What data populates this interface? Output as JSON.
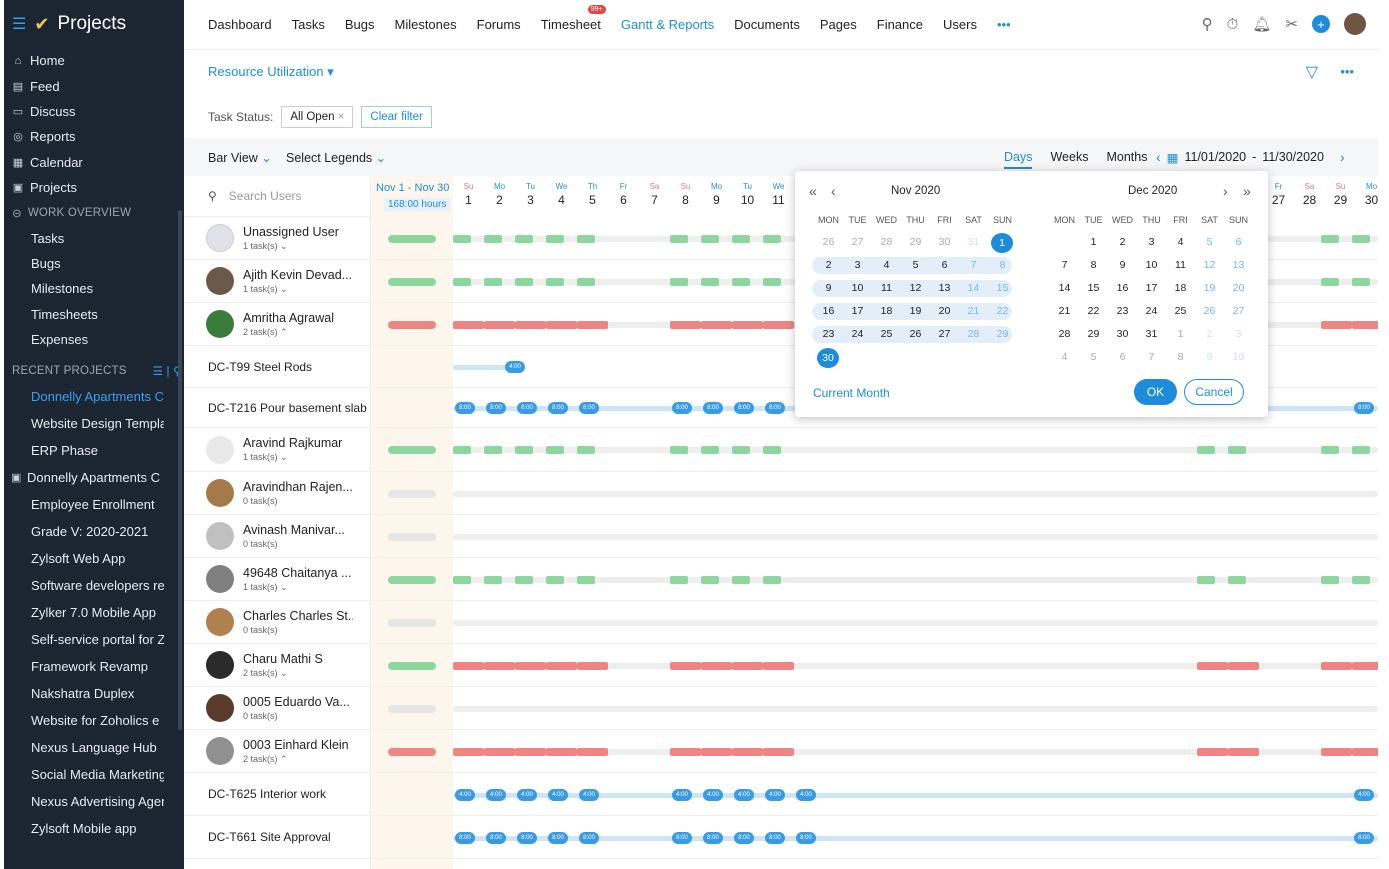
{
  "sidebar": {
    "title": "Projects",
    "items": [
      "Home",
      "Feed",
      "Discuss",
      "Reports",
      "Calendar",
      "Projects"
    ],
    "work_overview": "WORK OVERVIEW",
    "work_items": [
      "Tasks",
      "Bugs",
      "Milestones",
      "Timesheets",
      "Expenses"
    ],
    "recent_projects": "RECENT PROJECTS",
    "projects": [
      "Donnelly Apartments C",
      "Website Design Templa",
      "ERP Phase",
      "Donnelly Apartments C",
      "Employee Enrollment",
      "Grade V: 2020-2021",
      "Zylsoft Web App",
      "Software developers re",
      "Zylker 7.0 Mobile App",
      "Self-service portal for Z",
      "Framework Revamp",
      "Nakshatra Duplex",
      "Website for Zoholics e",
      "Nexus Language Hub",
      "Social Media Marketing",
      "Nexus Advertising Ager",
      "Zylsoft Mobile app"
    ]
  },
  "nav": {
    "items": [
      "Dashboard",
      "Tasks",
      "Bugs",
      "Milestones",
      "Forums",
      "Timesheet",
      "Gantt & Reports",
      "Documents",
      "Pages",
      "Finance",
      "Users",
      "•••"
    ],
    "badge": "99+"
  },
  "toolbar": {
    "report": "Resource Utilization",
    "task_status_label": "Task Status:",
    "chip": "All Open",
    "clear": "Clear filter",
    "bar_view": "Bar View",
    "legends": "Select Legends",
    "views": [
      "Days",
      "Weeks",
      "Months"
    ],
    "range_start": "11/01/2020",
    "range_sep": "-",
    "range_end": "11/30/2020"
  },
  "grid": {
    "search_placeholder": "Search Users",
    "summary_title": "Nov 1 - Nov 30",
    "summary_hours": "168:00 hours",
    "days": [
      {
        "n": "Su",
        "d": "1"
      },
      {
        "n": "Mo",
        "d": "2"
      },
      {
        "n": "Tu",
        "d": "3"
      },
      {
        "n": "We",
        "d": "4"
      },
      {
        "n": "Th",
        "d": "5"
      },
      {
        "n": "Fr",
        "d": "6"
      },
      {
        "n": "Sa",
        "d": "7"
      },
      {
        "n": "Su",
        "d": "8"
      },
      {
        "n": "Mo",
        "d": "9"
      },
      {
        "n": "Tu",
        "d": "10"
      },
      {
        "n": "We",
        "d": "11"
      }
    ],
    "days_right": [
      {
        "n": "Fr",
        "d": "27"
      },
      {
        "n": "Sa",
        "d": "28"
      },
      {
        "n": "Su",
        "d": "29"
      },
      {
        "n": "Mo",
        "d": "30"
      }
    ],
    "rows": [
      {
        "type": "user",
        "name": "Unassigned User",
        "tasks": "1 task(s)",
        "open": false
      },
      {
        "type": "user",
        "name": "Ajith Kevin Devad...",
        "tasks": "1 task(s)",
        "open": false
      },
      {
        "type": "user",
        "name": "Amritha Agrawal",
        "tasks": "2 task(s)",
        "open": true
      },
      {
        "type": "task",
        "name": "DC-T99 Steel Rods",
        "pill": "4:00"
      },
      {
        "type": "task",
        "name": "DC-T216 Pour basement slab",
        "pill": "8:00"
      },
      {
        "type": "user",
        "name": "Aravind Rajkumar",
        "tasks": "1 task(s)",
        "open": false
      },
      {
        "type": "user",
        "name": "Aravindhan Rajen...",
        "tasks": "0 task(s)",
        "open": null
      },
      {
        "type": "user",
        "name": "Avinash Manivar...",
        "tasks": "0 task(s)",
        "open": null
      },
      {
        "type": "user",
        "name": "49648 Chaitanya ...",
        "tasks": "1 task(s)",
        "open": false
      },
      {
        "type": "user",
        "name": "Charles Charles St...",
        "tasks": "0 task(s)",
        "open": null
      },
      {
        "type": "user",
        "name": "Charu Mathi S",
        "tasks": "2 task(s)",
        "open": false
      },
      {
        "type": "user",
        "name": "0005 Eduardo Va...",
        "tasks": "0 task(s)",
        "open": null
      },
      {
        "type": "user",
        "name": "0003 Einhard Klein",
        "tasks": "2 task(s)",
        "open": true
      },
      {
        "type": "task",
        "name": "DC-T625 Interior work",
        "pill": "4:00"
      },
      {
        "type": "task",
        "name": "DC-T661 Site Approval",
        "pill": "8:00"
      }
    ]
  },
  "calendar": {
    "left_month": "Nov 2020",
    "right_month": "Dec 2020",
    "weekdays": [
      "MON",
      "TUE",
      "WED",
      "THU",
      "FRI",
      "SAT",
      "SUN"
    ],
    "left_weeks": [
      [
        "26",
        "27",
        "28",
        "29",
        "30",
        "31",
        "1"
      ],
      [
        "2",
        "3",
        "4",
        "5",
        "6",
        "7",
        "8"
      ],
      [
        "9",
        "10",
        "11",
        "12",
        "13",
        "14",
        "15"
      ],
      [
        "16",
        "17",
        "18",
        "19",
        "20",
        "21",
        "22"
      ],
      [
        "23",
        "24",
        "25",
        "26",
        "27",
        "28",
        "29"
      ],
      [
        "30",
        "",
        "",
        "",
        "",
        "",
        ""
      ]
    ],
    "right_weeks": [
      [
        "",
        "1",
        "2",
        "3",
        "4",
        "5",
        "6"
      ],
      [
        "7",
        "8",
        "9",
        "10",
        "11",
        "12",
        "13"
      ],
      [
        "14",
        "15",
        "16",
        "17",
        "18",
        "19",
        "20"
      ],
      [
        "21",
        "22",
        "23",
        "24",
        "25",
        "26",
        "27"
      ],
      [
        "28",
        "29",
        "30",
        "31",
        "1",
        "2",
        "3"
      ],
      [
        "4",
        "5",
        "6",
        "7",
        "8",
        "9",
        "10"
      ]
    ],
    "current_month": "Current Month",
    "ok": "OK",
    "cancel": "Cancel"
  },
  "colors": {
    "accent": "#1e8cd9",
    "sidebar": "#1c2633",
    "green": "#8ed6a0",
    "red": "#ef8583"
  }
}
